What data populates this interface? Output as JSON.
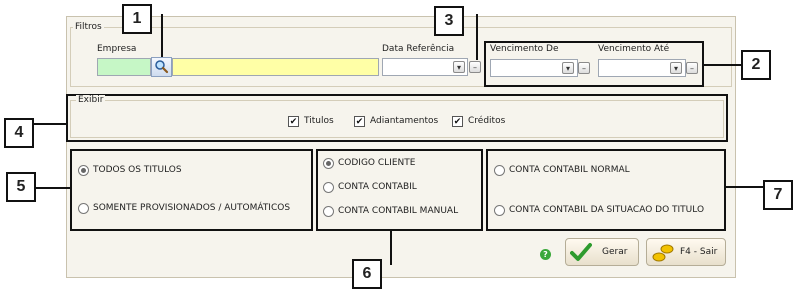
{
  "panel": {
    "title": "Filtros"
  },
  "filters": {
    "empresa_label": "Empresa",
    "data_referencia_label": "Data Referência",
    "vencimento_de_label": "Vencimento De",
    "vencimento_ate_label": "Vencimento Até",
    "search_icon": "magnifier-icon",
    "calendar_glyph": "–",
    "dropdown_glyph": "▾"
  },
  "exibir": {
    "title": "Exibir",
    "options": [
      {
        "label": "Titulos",
        "checked": true
      },
      {
        "label": "Adiantamentos",
        "checked": true
      },
      {
        "label": "Créditos",
        "checked": true
      }
    ],
    "check_glyph": "✔"
  },
  "group5": {
    "options": [
      "TODOS OS TITULOS",
      "SOMENTE PROVISIONADOS / AUTOMÁTICOS"
    ],
    "selected": 0
  },
  "group6": {
    "options": [
      "CODIGO CLIENTE",
      "CONTA CONTABIL",
      "CONTA CONTABIL MANUAL"
    ],
    "selected": 0
  },
  "group7": {
    "options": [
      "CONTA CONTABIL NORMAL",
      "CONTA CONTABIL DA SITUACAO DO TITULO"
    ],
    "selected": -1
  },
  "buttons": {
    "gerar": "Gerar",
    "sair": "F4 - Sair"
  },
  "callouts": [
    "1",
    "2",
    "3",
    "4",
    "5",
    "6",
    "7"
  ],
  "colors": {
    "empresa_code_bg": "#c6f7c6",
    "empresa_name_bg": "#ffffa6",
    "check_green": "#2e9b2e",
    "help_green": "#3aa83a"
  }
}
